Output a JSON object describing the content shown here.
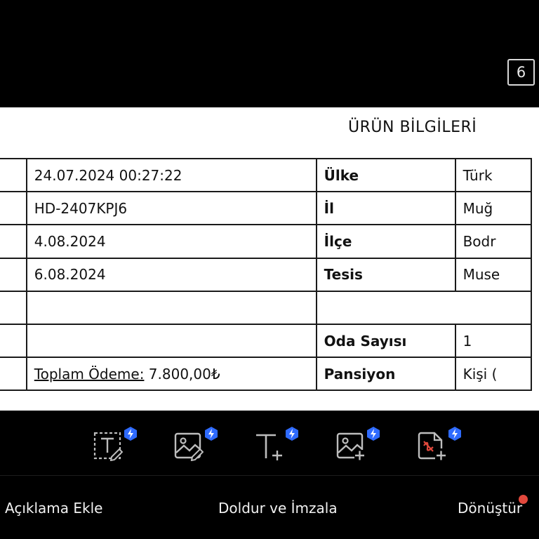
{
  "page_badge": "6",
  "document": {
    "title": "ÜRÜN BİLGİLERİ",
    "rows": [
      {
        "value": "24.07.2024 00:27:22",
        "label": "Ülke",
        "right": "Türk"
      },
      {
        "value": "HD-2407KPJ6",
        "label": "İl",
        "right": "Muğ"
      },
      {
        "value": "4.08.2024",
        "label": "İlçe",
        "right": "Bodr"
      },
      {
        "value": "6.08.2024",
        "label": "Tesis",
        "right": "Muse"
      },
      {
        "value": "",
        "label": "",
        "right": ""
      },
      {
        "value": "",
        "label": "Oda Sayısı",
        "right": "1"
      },
      {
        "value_label": "Toplam Ödeme:",
        "value": "7.800,00₺",
        "label": "Pansiyon",
        "right": "Kişi ("
      }
    ]
  },
  "toolbar": {
    "tools": [
      {
        "icon": "text-box-edit-icon"
      },
      {
        "icon": "image-edit-icon"
      },
      {
        "icon": "text-add-icon"
      },
      {
        "icon": "image-add-icon"
      },
      {
        "icon": "pdf-sign-add-icon"
      }
    ],
    "badge_icon": "lightning-bolt-icon",
    "badge_color": "#2f6bff"
  },
  "bottom_nav": {
    "items": [
      "Açıklama Ekle",
      "Doldur ve İmzala",
      "Dönüştür"
    ],
    "notification_color": "#e2483c"
  }
}
